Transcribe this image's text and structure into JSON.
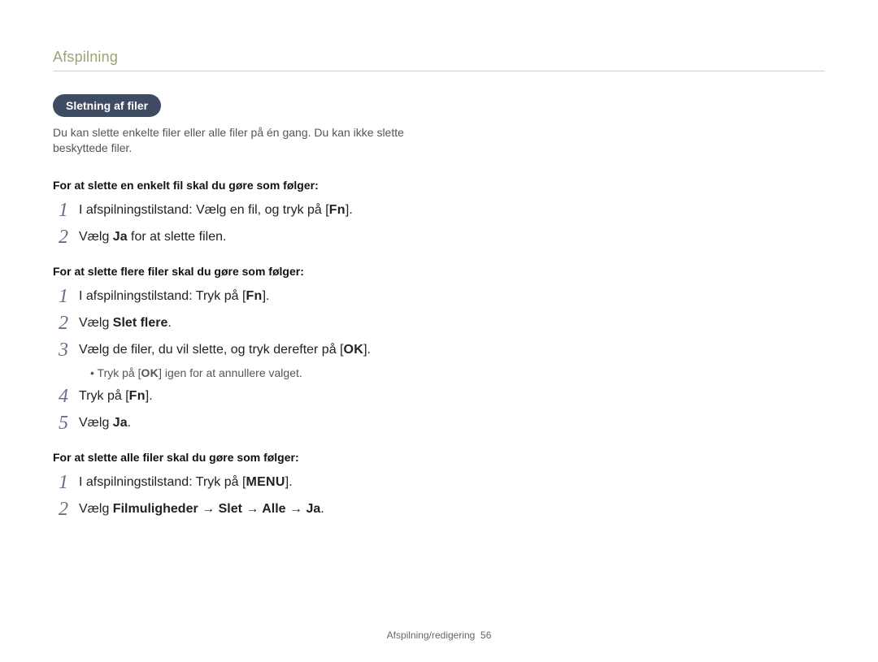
{
  "header": {
    "section": "Afspilning"
  },
  "pill": "Sletning af filer",
  "intro": "Du kan slette enkelte filer eller alle filer på én gang. Du kan ikke slette beskyttede filer.",
  "buttons": {
    "fn": "Fn",
    "ok": "OK",
    "menu": "MENU"
  },
  "sec1": {
    "title": "For at slette en enkelt fil skal du gøre som følger:",
    "s1a": "I afspilningstilstand: Vælg en fil, og tryk på [",
    "s1b": "].",
    "s2a": "Vælg ",
    "s2bold": "Ja",
    "s2b": " for at slette filen."
  },
  "sec2": {
    "title": "For at slette flere filer skal du gøre som følger:",
    "s1a": "I afspilningstilstand: Tryk på [",
    "s1b": "].",
    "s2a": "Vælg ",
    "s2bold": "Slet flere",
    "s2b": ".",
    "s3a": "Vælg de filer, du vil slette, og tryk derefter på [",
    "s3b": "].",
    "bullet_a": "Tryk på [",
    "bullet_b": "] igen for at annullere valget.",
    "s4a": "Tryk på [",
    "s4b": "].",
    "s5a": "Vælg ",
    "s5bold": "Ja",
    "s5b": "."
  },
  "sec3": {
    "title": "For at slette alle filer skal du gøre som følger:",
    "s1a": "I afspilningstilstand: Tryk på [",
    "s1b": "].",
    "s2a": "Vælg ",
    "s2bold": "Filmuligheder → Slet → Alle → Ja",
    "s2b": "."
  },
  "footer": {
    "label": "Afspilning/redigering",
    "page": "56"
  }
}
